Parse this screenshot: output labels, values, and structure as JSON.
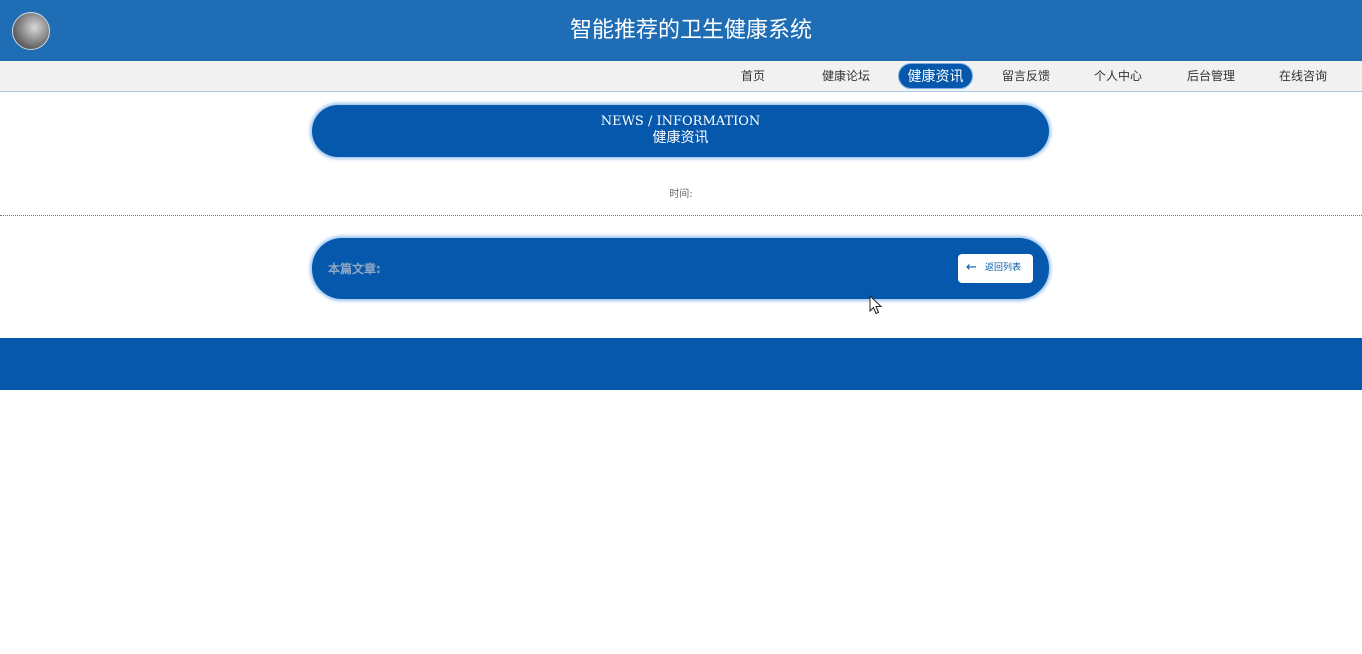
{
  "header": {
    "site_title": "智能推荐的卫生健康系统",
    "bg_color": "#1e6db5"
  },
  "nav": {
    "items": [
      {
        "label": "首页",
        "active": false
      },
      {
        "label": "健康论坛",
        "active": false
      },
      {
        "label": "健康资讯",
        "active": true
      },
      {
        "label": "留言反馈",
        "active": false
      },
      {
        "label": "个人中心",
        "active": false
      },
      {
        "label": "后台管理",
        "active": false
      },
      {
        "label": "在线咨询",
        "active": false
      }
    ],
    "active_color": "#0558ab"
  },
  "banner": {
    "title_en": "NEWS / INFORMATION",
    "title_cn": "健康资讯"
  },
  "article": {
    "time_label": "时间:",
    "this_article_label": "本篇文章:",
    "back_button_label": "返回列表",
    "back_icon": "arrow-left-icon"
  },
  "theme": {
    "primary": "#0558ab"
  }
}
